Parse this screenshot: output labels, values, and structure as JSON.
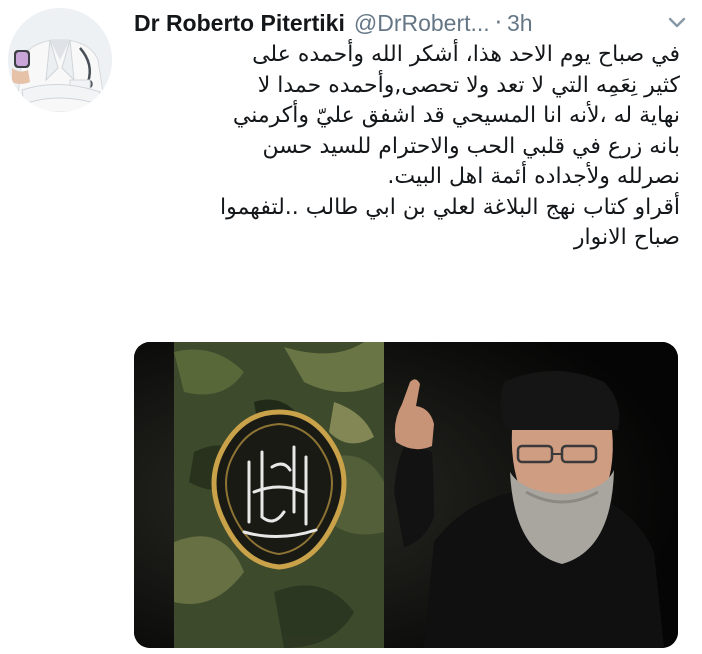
{
  "tweet": {
    "author_name": "Dr Roberto Pitertiki",
    "author_handle": "@DrRobert...",
    "separator": "·",
    "timestamp": "3h",
    "lines": [
      "في صباح يوم الاحد هذا، أشكر الله وأحمده على",
      "كثير نِعَمِه التي لا تعد ولا تحصى,وأحمده حمدا لا",
      "نهاية له ،لأنه انا المسيحي قد اشفق عليّ وأكرمني",
      "بانه زرع في قلبي الحب والاحترام للسيد حسن",
      "نصرلله ولأجداده أئمة اهل البيت.",
      "أقراو كتاب نهج البلاغة لعلي بن ابي طالب ..لتفهموا",
      "صباح الانوار"
    ]
  },
  "icons": {
    "avatar": "doctor-avatar",
    "menu": "chevron-down-icon"
  },
  "colors": {
    "text_primary": "#14171a",
    "text_secondary": "#657786",
    "background": "#ffffff"
  }
}
